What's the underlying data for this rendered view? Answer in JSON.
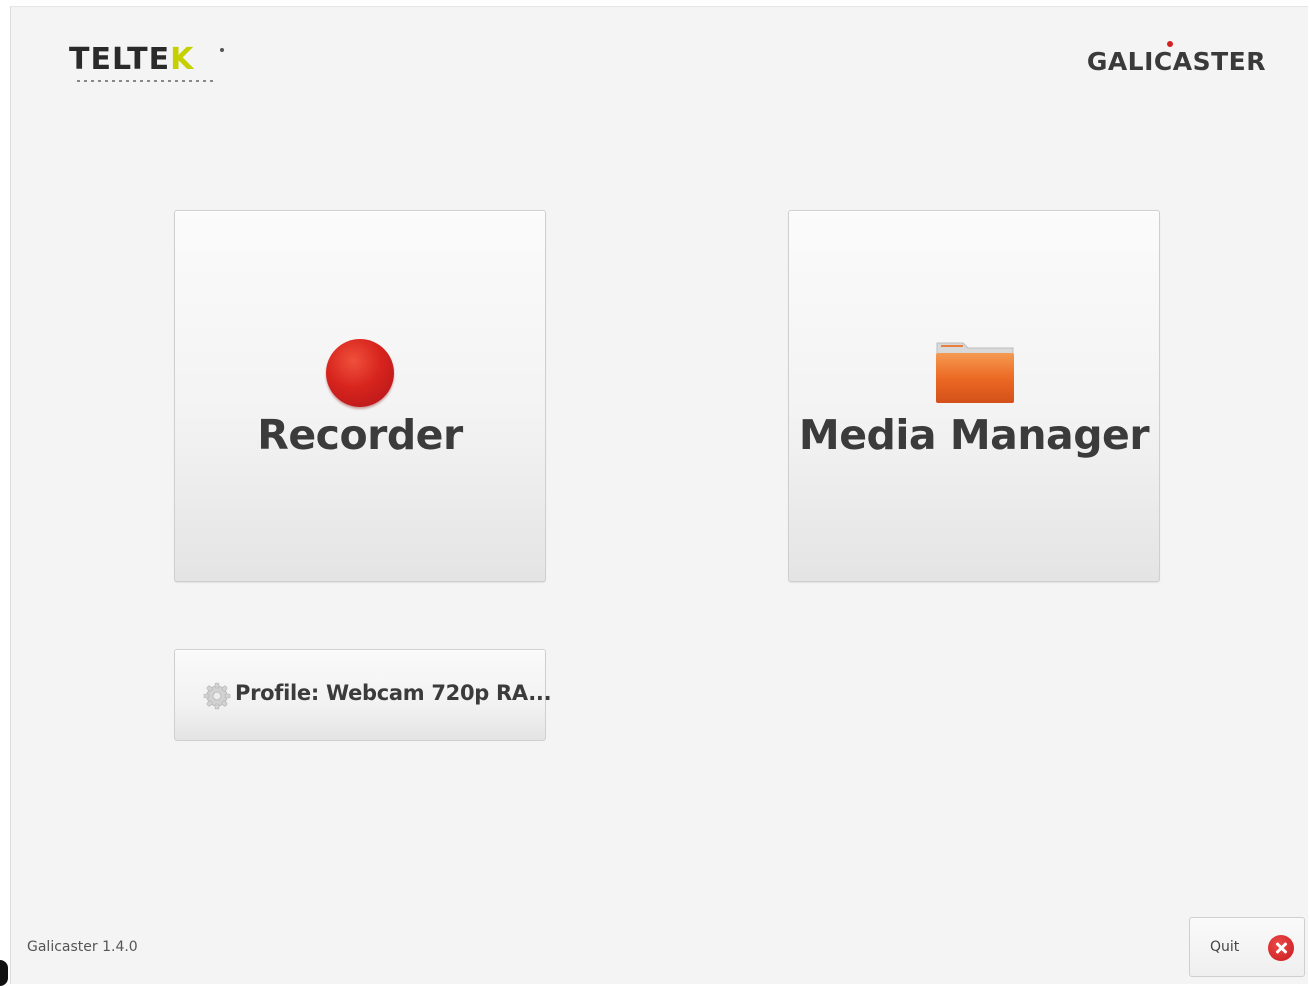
{
  "header": {
    "left_logo_text_prefix": "TELTE",
    "left_logo_text_accent": "K",
    "right_logo_text": "GALICASTER"
  },
  "main": {
    "recorder_button": {
      "label": "Recorder",
      "icon": "record-icon"
    },
    "media_manager_button": {
      "label": "Media Manager",
      "icon": "folder-icon"
    },
    "profile_button": {
      "label": "Profile: Webcam 720p RA...",
      "icon": "gear-icon"
    }
  },
  "footer": {
    "version": "Galicaster 1.4.0",
    "quit_label": "Quit",
    "quit_icon": "close-icon"
  },
  "colors": {
    "background": "#f4f4f4",
    "record_red": "#d7241d",
    "folder_orange": "#e8641e",
    "teltek_accent": "#c5d000",
    "text_dark": "#3b3b3b"
  }
}
